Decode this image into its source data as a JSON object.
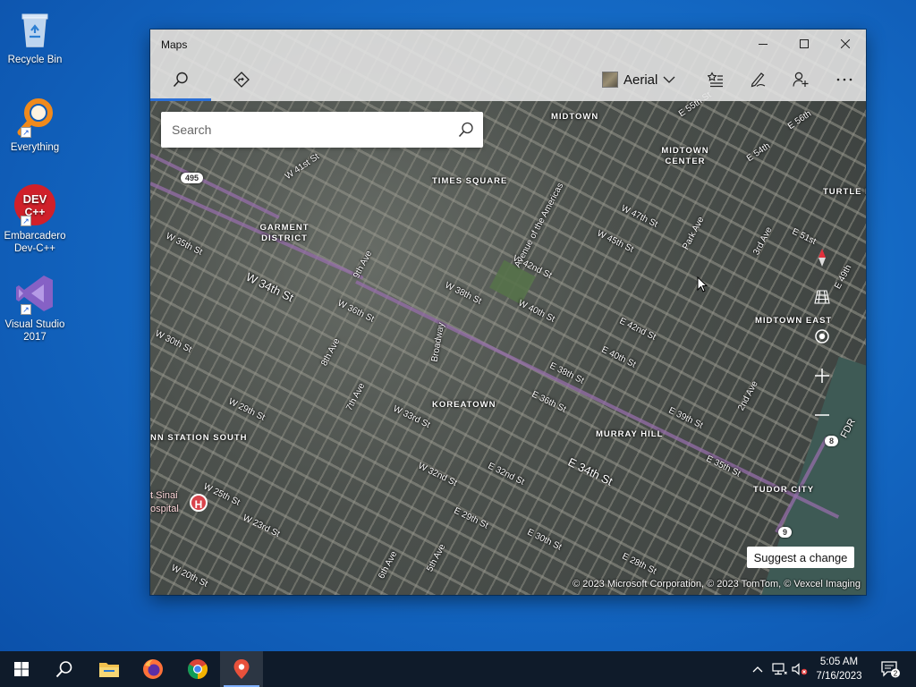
{
  "desktop": {
    "icons": [
      {
        "label": "Recycle Bin"
      },
      {
        "label": "Everything"
      },
      {
        "label": "Embarcadero Dev-C++"
      },
      {
        "label": "Visual Studio 2017"
      }
    ],
    "devcpp_badge": "DEV C++"
  },
  "window": {
    "title": "Maps",
    "map_style": "Aerial",
    "search_placeholder": "Search",
    "suggest_change": "Suggest a change",
    "attribution": "© 2023 Microsoft Corporation, © 2023 TomTom, © Vexcel Imaging"
  },
  "map": {
    "districts": [
      "MIDTOWN",
      "TIMES SQUARE",
      "GARMENT DISTRICT",
      "MIDTOWN CENTER",
      "TURTLE B",
      "MIDTOWN EAST",
      "KOREATOWN",
      "MURRAY HILL",
      "TUDOR CITY",
      "NN STATION SOUTH"
    ],
    "streets": [
      "W 41st St",
      "W 35th St",
      "W 34th St",
      "W 30th St",
      "W 36th St",
      "W 38th St",
      "W 40th St",
      "W 42nd St",
      "W 45th St",
      "W 47th St",
      "W 33rd St",
      "W 32nd St",
      "W 29th St",
      "W 25th St",
      "W 23rd St",
      "W 20th St",
      "E 40th St",
      "E 42nd St",
      "E 38th St",
      "E 36th St",
      "E 34th St",
      "E 32nd St",
      "E 30th St",
      "E 29th St",
      "E 39th St",
      "E 35th St",
      "E 28th St",
      "E 54th",
      "E 51st",
      "E 49th",
      "E 55th St",
      "E 56th",
      "9th Ave",
      "8th Ave",
      "7th Ave",
      "6th Ave",
      "5th Ave",
      "Park Ave",
      "3rd Ave",
      "2nd Ave",
      "Broadway",
      "Avenue of the Americas",
      "FDR"
    ],
    "shields": [
      "495",
      "8",
      "9"
    ],
    "hospital_marker": "H",
    "hospital_label": "t Sinai\nospital",
    "compass_icon": "compass-icon"
  },
  "taskbar": {
    "time": "5:05 AM",
    "date": "7/16/2023",
    "notification_count": "2"
  }
}
